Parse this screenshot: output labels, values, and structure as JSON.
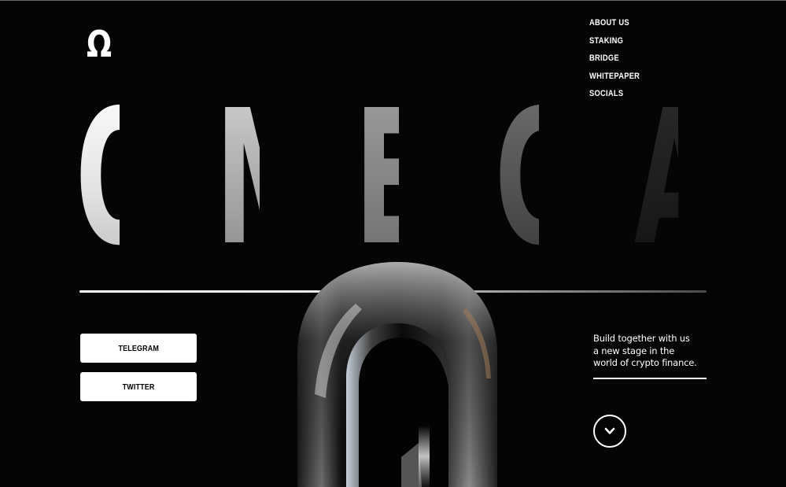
{
  "brand": {
    "logo_glyph": "Ω"
  },
  "nav": {
    "items": [
      {
        "label": "ABOUT US"
      },
      {
        "label": "STAKING"
      },
      {
        "label": "BRIDGE"
      },
      {
        "label": "WHITEPAPER"
      },
      {
        "label": "SOCIALS"
      }
    ]
  },
  "hero": {
    "letters": [
      "O",
      "M",
      "E",
      "G",
      "A"
    ]
  },
  "buttons": {
    "telegram": "TELEGRAM",
    "twitter": "TWITTER"
  },
  "tagline": {
    "line1": "Build together with us",
    "line2": "a new stage in the",
    "line3": "world of crypto finance."
  },
  "icons": {
    "scroll": "chevron-down-icon",
    "sculpture": "omega-arch-sculpture"
  },
  "colors": {
    "background": "#000000",
    "foreground": "#ffffff"
  }
}
